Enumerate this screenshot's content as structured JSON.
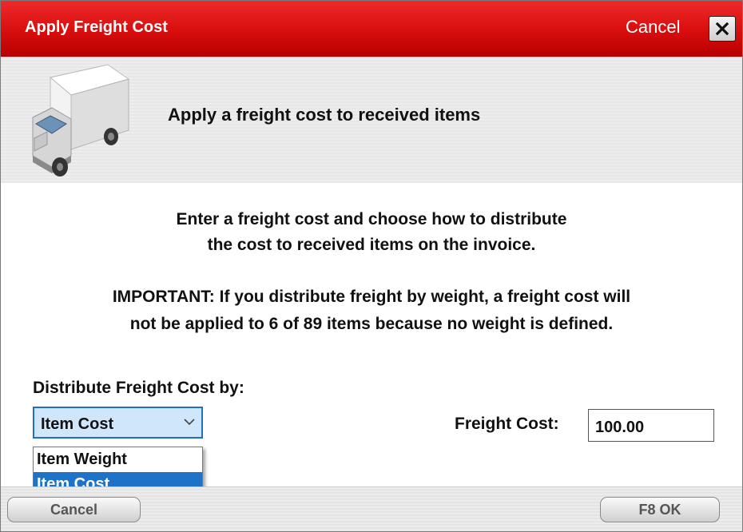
{
  "dialog": {
    "title": "Apply Freight Cost",
    "cancel_link": "Cancel",
    "close_icon": "close-icon"
  },
  "header": {
    "icon": "truck-icon",
    "heading": "Apply a freight cost to received items"
  },
  "body": {
    "instructions": [
      "Enter a freight cost and choose how to distribute",
      "the cost to received items on the invoice."
    ],
    "important": [
      "IMPORTANT: If you distribute freight by weight, a freight cost will",
      "not be applied to 6 of 89 items because no weight is defined."
    ],
    "distribute_label": "Distribute Freight Cost by:",
    "distribute_select": {
      "selected": "Item Cost",
      "options": [
        "Item Weight",
        "Item Cost"
      ],
      "highlighted": "Item Cost"
    },
    "freight_cost_label": "Freight Cost:",
    "freight_cost_value": "100.00"
  },
  "footer": {
    "cancel_label": "Cancel",
    "ok_label": "F8 OK"
  },
  "colors": {
    "titlebar": "#d80d0d",
    "select_border": "#1f6fc7",
    "select_bg": "#cfe6fb",
    "highlight": "#1e73c8"
  }
}
